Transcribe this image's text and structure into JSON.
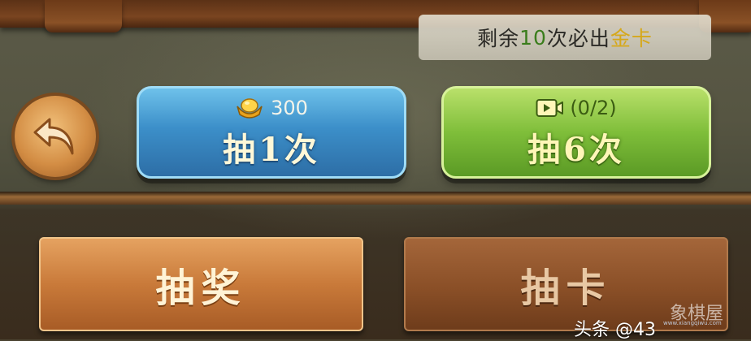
{
  "banner": {
    "prefix": "剩余",
    "count": "10",
    "middle": "次必出",
    "reward": "金卡"
  },
  "back_button": {
    "icon": "return-arrow-icon"
  },
  "draw_buttons": [
    {
      "icon": "gold-ingot-icon",
      "cost": "300",
      "label": "抽1次"
    },
    {
      "icon": "video-camera-icon",
      "cost": "(0/2)",
      "label": "抽6次"
    }
  ],
  "tabs": [
    {
      "label": "抽奖",
      "active": true
    },
    {
      "label": "抽卡",
      "active": false
    }
  ],
  "watermark": {
    "user": "头条 @43",
    "logo": "象棋屋",
    "url": "www.xiangqiwu.com"
  },
  "colors": {
    "highlight_green": "#3a7d1c",
    "highlight_gold": "#d6a81a",
    "blue_button": "#3c8fc9",
    "green_button": "#7fbe3a",
    "tab_active": "#c97a3a",
    "tab_inactive": "#8a4f27"
  }
}
